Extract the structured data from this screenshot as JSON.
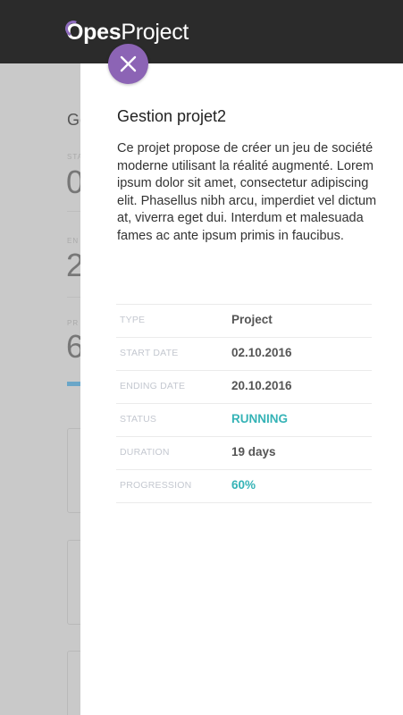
{
  "app": {
    "logo_bold": "Opes",
    "logo_light": "Project",
    "accent_color": "#8c64b5"
  },
  "background": {
    "title": "Ge",
    "stats": [
      {
        "label": "STA",
        "value": "0"
      },
      {
        "label": "EN",
        "value": "2"
      },
      {
        "label": "PR",
        "value": "6"
      }
    ]
  },
  "panel": {
    "close_icon": "close-icon",
    "title": "Gestion projet2",
    "description": "Ce projet propose de créer un jeu de société moderne utilisant la réalité augmenté. Lorem ipsum dolor sit amet, consectetur adipiscing elit. Phasellus nibh arcu, imperdiet vel dictum at, viverra eget dui. Interdum et malesuada fames ac ante ipsum primis in faucibus.",
    "details": [
      {
        "label": "TYPE",
        "value": "Project"
      },
      {
        "label": "START DATE",
        "value": "02.10.2016"
      },
      {
        "label": "ENDING DATE",
        "value": "20.10.2016"
      },
      {
        "label": "STATUS",
        "value": "RUNNING"
      },
      {
        "label": "DURATION",
        "value": "19 days"
      },
      {
        "label": "PROGRESSION",
        "value": "60%"
      }
    ],
    "status_color": "#35b3b6"
  }
}
